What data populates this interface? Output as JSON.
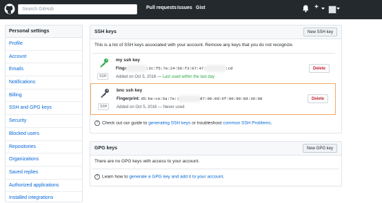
{
  "header": {
    "search_placeholder": "Search GitHub",
    "nav": [
      "Pull requests",
      "Issues",
      "Gist"
    ],
    "plus": "+"
  },
  "sidebar": {
    "title": "Personal settings",
    "items": [
      "Profile",
      "Account",
      "Emails",
      "Notifications",
      "Billing",
      "SSH and GPG keys",
      "Security",
      "Blocked users",
      "Repositories",
      "Organizations",
      "Saved replies",
      "Authorized applications",
      "Installed integrations"
    ]
  },
  "ssh": {
    "title": "SSH keys",
    "new_button": "New SSH key",
    "intro": "This is a list of SSH keys associated with your account. Remove any keys that you do not recognize.",
    "badge": "SSH",
    "fingerprint_label": "Fingerprint:",
    "delete_label": "Delete",
    "keys": [
      {
        "name": "my ssh key",
        "label_partial": "Finge",
        "hash_a": ":2c:f5:7e:24:56:f3:07:47:",
        "hash_b": ":cd",
        "added": "Added on Oct 5, 2016 —",
        "recency": "Last used within the last day"
      },
      {
        "name": "bnc ssh key",
        "hash_a": "d5:be:ce:5a:7e:1",
        "hash_b": "d7:90:0d:6f:90:90:8d:30:98",
        "added": "Added on Oct 5, 2016 —",
        "recency": "Never used"
      }
    ],
    "guide": {
      "pre": "Check out our guide to ",
      "link1": "generating SSH keys",
      "mid": " or troubleshoot ",
      "link2": "common SSH Problems",
      "post": "."
    }
  },
  "gpg": {
    "title": "GPG keys",
    "new_button": "New GPG key",
    "empty": "There are no GPG keys with access to your account.",
    "guide": {
      "pre": "Learn how to ",
      "link": "generate a GPG key and add it to your account",
      "post": "."
    }
  },
  "colors": {
    "header": "#24292e",
    "link": "#0366d6",
    "danger": "#cb2431",
    "recent": "#28a745",
    "highlight": "#f0a868"
  }
}
